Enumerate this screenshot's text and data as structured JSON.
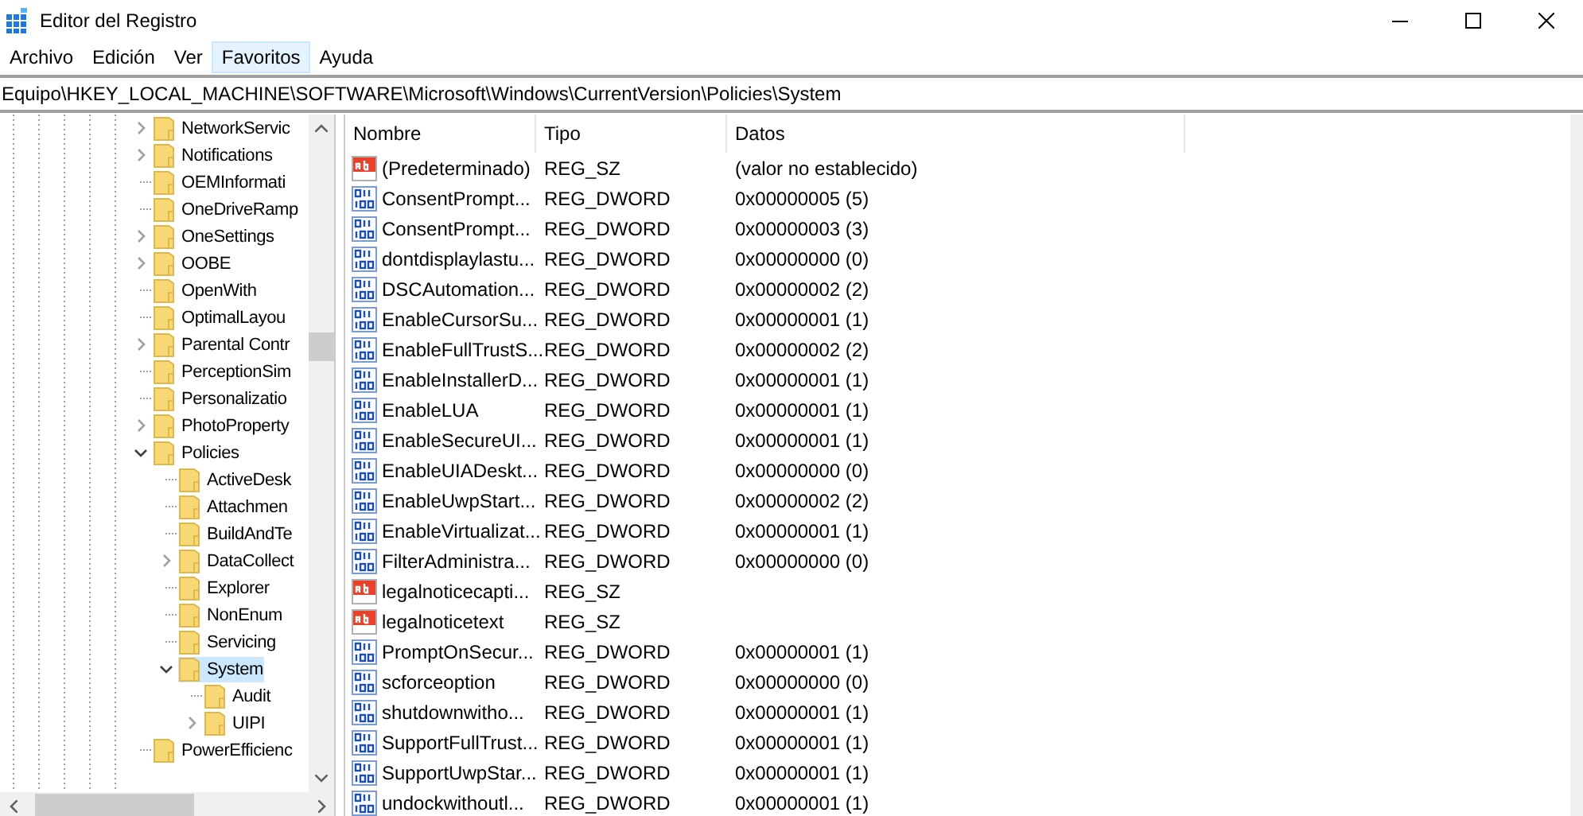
{
  "window": {
    "title": "Editor del Registro"
  },
  "menu": [
    {
      "label": "Archivo",
      "highlighted": false
    },
    {
      "label": "Edición",
      "highlighted": false
    },
    {
      "label": "Ver",
      "highlighted": false
    },
    {
      "label": "Favoritos",
      "highlighted": true
    },
    {
      "label": "Ayuda",
      "highlighted": false
    }
  ],
  "address_bar": {
    "value": "Equipo\\HKEY_LOCAL_MACHINE\\SOFTWARE\\Microsoft\\Windows\\CurrentVersion\\Policies\\System"
  },
  "tree": [
    {
      "label": "NetworkServic",
      "expandable": true,
      "expanded": false,
      "selected": false
    },
    {
      "label": "Notifications",
      "expandable": true,
      "expanded": false,
      "selected": false
    },
    {
      "label": "OEMInformati",
      "expandable": false,
      "selected": false
    },
    {
      "label": "OneDriveRamp",
      "expandable": false,
      "selected": false
    },
    {
      "label": "OneSettings",
      "expandable": true,
      "expanded": false,
      "selected": false
    },
    {
      "label": "OOBE",
      "expandable": true,
      "expanded": false,
      "selected": false
    },
    {
      "label": "OpenWith",
      "expandable": false,
      "selected": false
    },
    {
      "label": "OptimalLayou",
      "expandable": false,
      "selected": false
    },
    {
      "label": "Parental Contr",
      "expandable": true,
      "expanded": false,
      "selected": false
    },
    {
      "label": "PerceptionSim",
      "expandable": false,
      "selected": false
    },
    {
      "label": "Personalizatio",
      "expandable": false,
      "selected": false
    },
    {
      "label": "PhotoProperty",
      "expandable": true,
      "expanded": false,
      "selected": false
    },
    {
      "label": "Policies",
      "expandable": true,
      "expanded": true,
      "selected": false,
      "children": [
        {
          "label": "ActiveDesk",
          "expandable": false,
          "selected": false
        },
        {
          "label": "Attachmen",
          "expandable": false,
          "selected": false
        },
        {
          "label": "BuildAndTe",
          "expandable": false,
          "selected": false
        },
        {
          "label": "DataCollect",
          "expandable": true,
          "expanded": false,
          "selected": false
        },
        {
          "label": "Explorer",
          "expandable": false,
          "selected": false
        },
        {
          "label": "NonEnum",
          "expandable": false,
          "selected": false
        },
        {
          "label": "Servicing",
          "expandable": false,
          "selected": false
        },
        {
          "label": "System",
          "expandable": true,
          "expanded": true,
          "selected": true,
          "children": [
            {
              "label": "Audit",
              "expandable": false,
              "selected": false
            },
            {
              "label": "UIPI",
              "expandable": true,
              "expanded": false,
              "selected": false
            }
          ]
        }
      ]
    },
    {
      "label": "PowerEfficienc",
      "expandable": false,
      "selected": false
    }
  ],
  "table": {
    "columns": [
      "Nombre",
      "Tipo",
      "Datos"
    ],
    "rows": [
      {
        "kind": "sz",
        "name": "(Predeterminado)",
        "type": "REG_SZ",
        "data": "(valor no establecido)"
      },
      {
        "kind": "dword",
        "name": "ConsentPrompt...",
        "type": "REG_DWORD",
        "data": "0x00000005 (5)"
      },
      {
        "kind": "dword",
        "name": "ConsentPrompt...",
        "type": "REG_DWORD",
        "data": "0x00000003 (3)"
      },
      {
        "kind": "dword",
        "name": "dontdisplaylastu...",
        "type": "REG_DWORD",
        "data": "0x00000000 (0)"
      },
      {
        "kind": "dword",
        "name": "DSCAutomation...",
        "type": "REG_DWORD",
        "data": "0x00000002 (2)"
      },
      {
        "kind": "dword",
        "name": "EnableCursorSu...",
        "type": "REG_DWORD",
        "data": "0x00000001 (1)"
      },
      {
        "kind": "dword",
        "name": "EnableFullTrustS...",
        "type": "REG_DWORD",
        "data": "0x00000002 (2)"
      },
      {
        "kind": "dword",
        "name": "EnableInstallerD...",
        "type": "REG_DWORD",
        "data": "0x00000001 (1)"
      },
      {
        "kind": "dword",
        "name": "EnableLUA",
        "type": "REG_DWORD",
        "data": "0x00000001 (1)"
      },
      {
        "kind": "dword",
        "name": "EnableSecureUI...",
        "type": "REG_DWORD",
        "data": "0x00000001 (1)"
      },
      {
        "kind": "dword",
        "name": "EnableUIADeskt...",
        "type": "REG_DWORD",
        "data": "0x00000000 (0)"
      },
      {
        "kind": "dword",
        "name": "EnableUwpStart...",
        "type": "REG_DWORD",
        "data": "0x00000002 (2)"
      },
      {
        "kind": "dword",
        "name": "EnableVirtualizat...",
        "type": "REG_DWORD",
        "data": "0x00000001 (1)"
      },
      {
        "kind": "dword",
        "name": "FilterAdministra...",
        "type": "REG_DWORD",
        "data": "0x00000000 (0)"
      },
      {
        "kind": "sz",
        "name": "legalnoticecapti...",
        "type": "REG_SZ"
      },
      {
        "kind": "sz",
        "name": "legalnoticetext",
        "type": "REG_SZ"
      },
      {
        "kind": "dword",
        "name": "PromptOnSecur...",
        "type": "REG_DWORD",
        "data": "0x00000001 (1)"
      },
      {
        "kind": "dword",
        "name": "scforceoption",
        "type": "REG_DWORD",
        "data": "0x00000000 (0)"
      },
      {
        "kind": "dword",
        "name": "shutdownwitho...",
        "type": "REG_DWORD",
        "data": "0x00000001 (1)"
      },
      {
        "kind": "dword",
        "name": "SupportFullTrust...",
        "type": "REG_DWORD",
        "data": "0x00000001 (1)"
      },
      {
        "kind": "dword",
        "name": "SupportUwpStar...",
        "type": "REG_DWORD",
        "data": "0x00000001 (1)"
      },
      {
        "kind": "dword",
        "name": "undockwithoutl...",
        "type": "REG_DWORD",
        "data": "0x00000001 (1)"
      }
    ]
  }
}
